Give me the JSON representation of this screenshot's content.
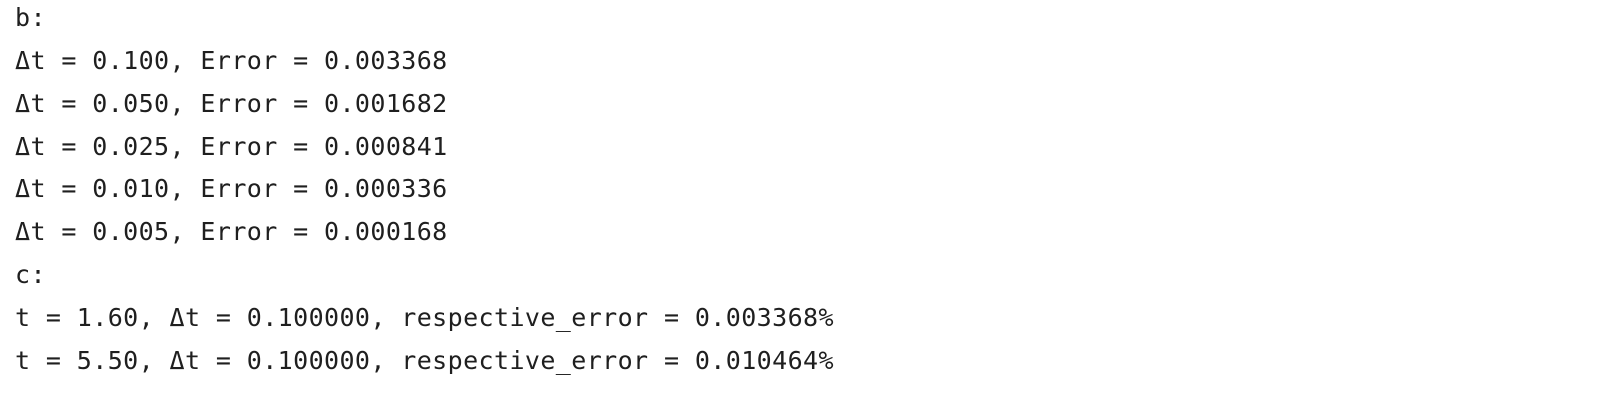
{
  "console": {
    "lines": [
      "b:",
      "Δt = 0.100, Error = 0.003368",
      "Δt = 0.050, Error = 0.001682",
      "Δt = 0.025, Error = 0.000841",
      "Δt = 0.010, Error = 0.000336",
      "Δt = 0.005, Error = 0.000168",
      "c:",
      "t = 1.60, Δt = 0.100000, respective_error = 0.003368%",
      "t = 5.50, Δt = 0.100000, respective_error = 0.010464%"
    ]
  }
}
